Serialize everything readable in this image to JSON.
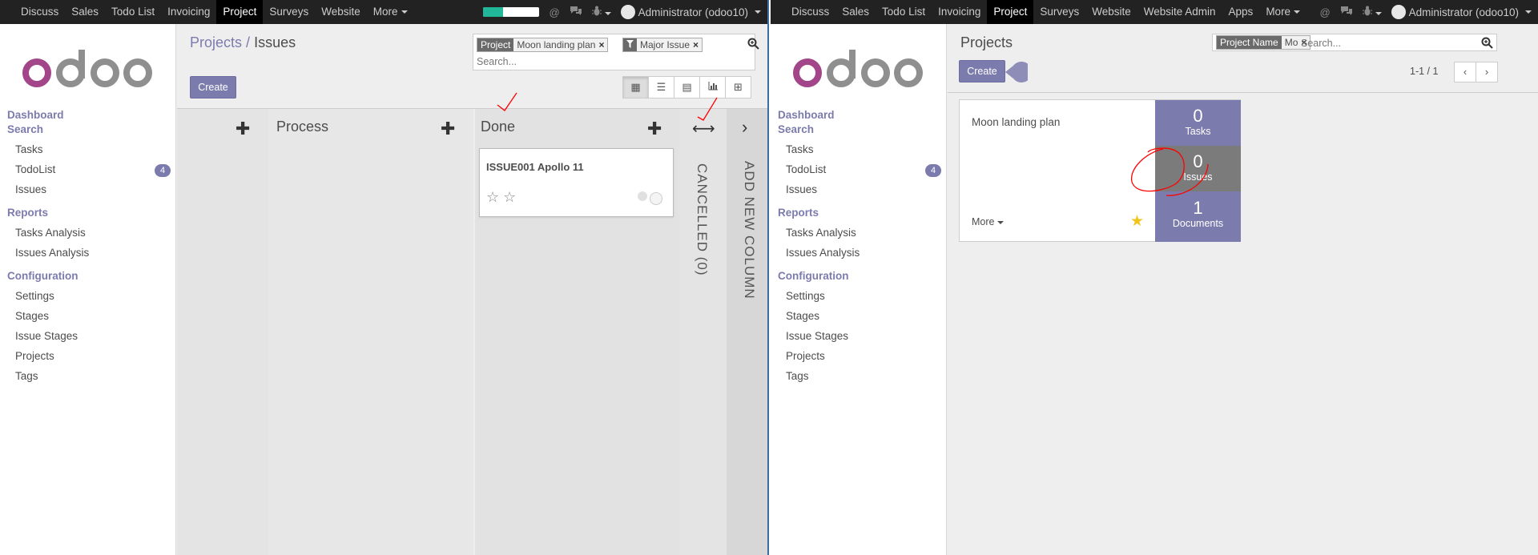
{
  "left": {
    "topbar": {
      "apps": [
        "Discuss",
        "Sales",
        "Todo List",
        "Invoicing",
        "Project",
        "Surveys",
        "Website"
      ],
      "more": "More",
      "user": "Administrator (odoo10)",
      "progress": 0.35
    },
    "sidebar": {
      "sections": {
        "dashboard": "Dashboard",
        "search": "Search",
        "reports": "Reports",
        "configuration": "Configuration"
      },
      "search_items": [
        "Tasks",
        "TodoList",
        "Issues"
      ],
      "todolist_badge": "4",
      "report_items": [
        "Tasks Analysis",
        "Issues Analysis"
      ],
      "config_items": [
        "Settings",
        "Stages",
        "Issue Stages",
        "Projects",
        "Tags"
      ]
    },
    "breadcrumb": {
      "parent": "Projects",
      "separator": "/",
      "current": "Issues"
    },
    "create_label": "Create",
    "search": {
      "facets": [
        {
          "label": "Project",
          "value": "Moon landing plan"
        },
        {
          "label": "filter-icon",
          "value": "Major Issue"
        }
      ],
      "placeholder": "Search..."
    },
    "columns": [
      {
        "title": "Process"
      },
      {
        "title": "Done"
      }
    ],
    "card": {
      "title": "ISSUE001 Apollo 11"
    },
    "folded_column": "CANCELLED (0)",
    "add_column": "ADD NEW COLUMN"
  },
  "right": {
    "topbar": {
      "apps": [
        "Discuss",
        "Sales",
        "Todo List",
        "Invoicing",
        "Project",
        "Surveys",
        "Website",
        "Website Admin",
        "Apps"
      ],
      "more": "More",
      "user": "Administrator (odoo10)"
    },
    "sidebar": {
      "sections": {
        "dashboard": "Dashboard",
        "search": "Search",
        "reports": "Reports",
        "configuration": "Configuration"
      },
      "search_items": [
        "Tasks",
        "TodoList",
        "Issues"
      ],
      "todolist_badge": "4",
      "report_items": [
        "Tasks Analysis",
        "Issues Analysis"
      ],
      "config_items": [
        "Settings",
        "Stages",
        "Issue Stages",
        "Projects",
        "Tags"
      ]
    },
    "title": "Projects",
    "create_label": "Create",
    "search": {
      "facet_label": "Project Name",
      "facet_value": "Mo",
      "placeholder": "Search..."
    },
    "pager": "1-1 / 1",
    "project": {
      "name": "Moon landing plan",
      "more": "More",
      "stats": [
        {
          "count": "0",
          "label": "Tasks"
        },
        {
          "count": "0",
          "label": "Issues"
        },
        {
          "count": "1",
          "label": "Documents"
        }
      ]
    }
  },
  "colors": {
    "brand": "#7c7bad",
    "topbar": "#222222",
    "annotation": "#ff0000",
    "star_active": "#f0c419"
  }
}
